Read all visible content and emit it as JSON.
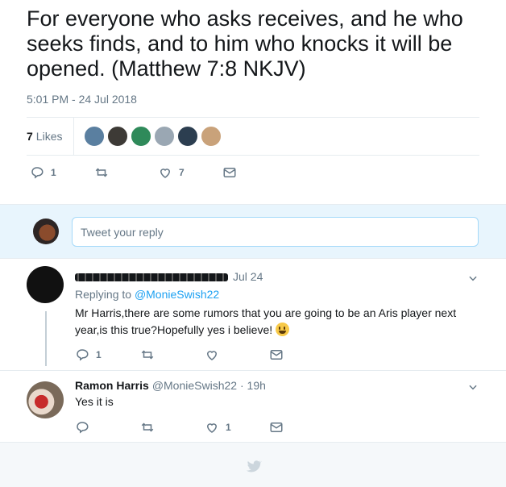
{
  "tweet": {
    "text": "For everyone who asks receives, and he who seeks finds, and to him who knocks it will be opened. (Matthew 7:8 NKJV)",
    "timestamp": "5:01 PM - 24 Jul 2018",
    "likes_count": "7",
    "likes_label": "Likes",
    "liker_avatar_colors": [
      "#5a7fa0",
      "#3d3a36",
      "#2f8a5a",
      "#9aa7b3",
      "#2c3e50",
      "#c9a27a"
    ],
    "actions": {
      "reply_count": "1",
      "retweet_count": "",
      "like_count": "7"
    }
  },
  "reply_box": {
    "placeholder": "Tweet your reply"
  },
  "replies": [
    {
      "date": "Jul 24",
      "replying_to_prefix": "Replying to",
      "replying_to_handle": "@MonieSwish22",
      "text": "Mr Harris,there are some rumors that you are going to be an Aris player next year,is this true?Hopefully yes i believe!",
      "reply_count": "1",
      "retweet_count": "",
      "like_count": ""
    },
    {
      "name": "Ramon Harris",
      "handle": "@MonieSwish22",
      "separator": "·",
      "time": "19h",
      "text": "Yes it is",
      "reply_count": "",
      "retweet_count": "",
      "like_count": "1"
    }
  ],
  "colors": {
    "accent": "#1da1f2",
    "icon_gray": "#657786",
    "reply_box_bg": "#e8f5fd"
  }
}
